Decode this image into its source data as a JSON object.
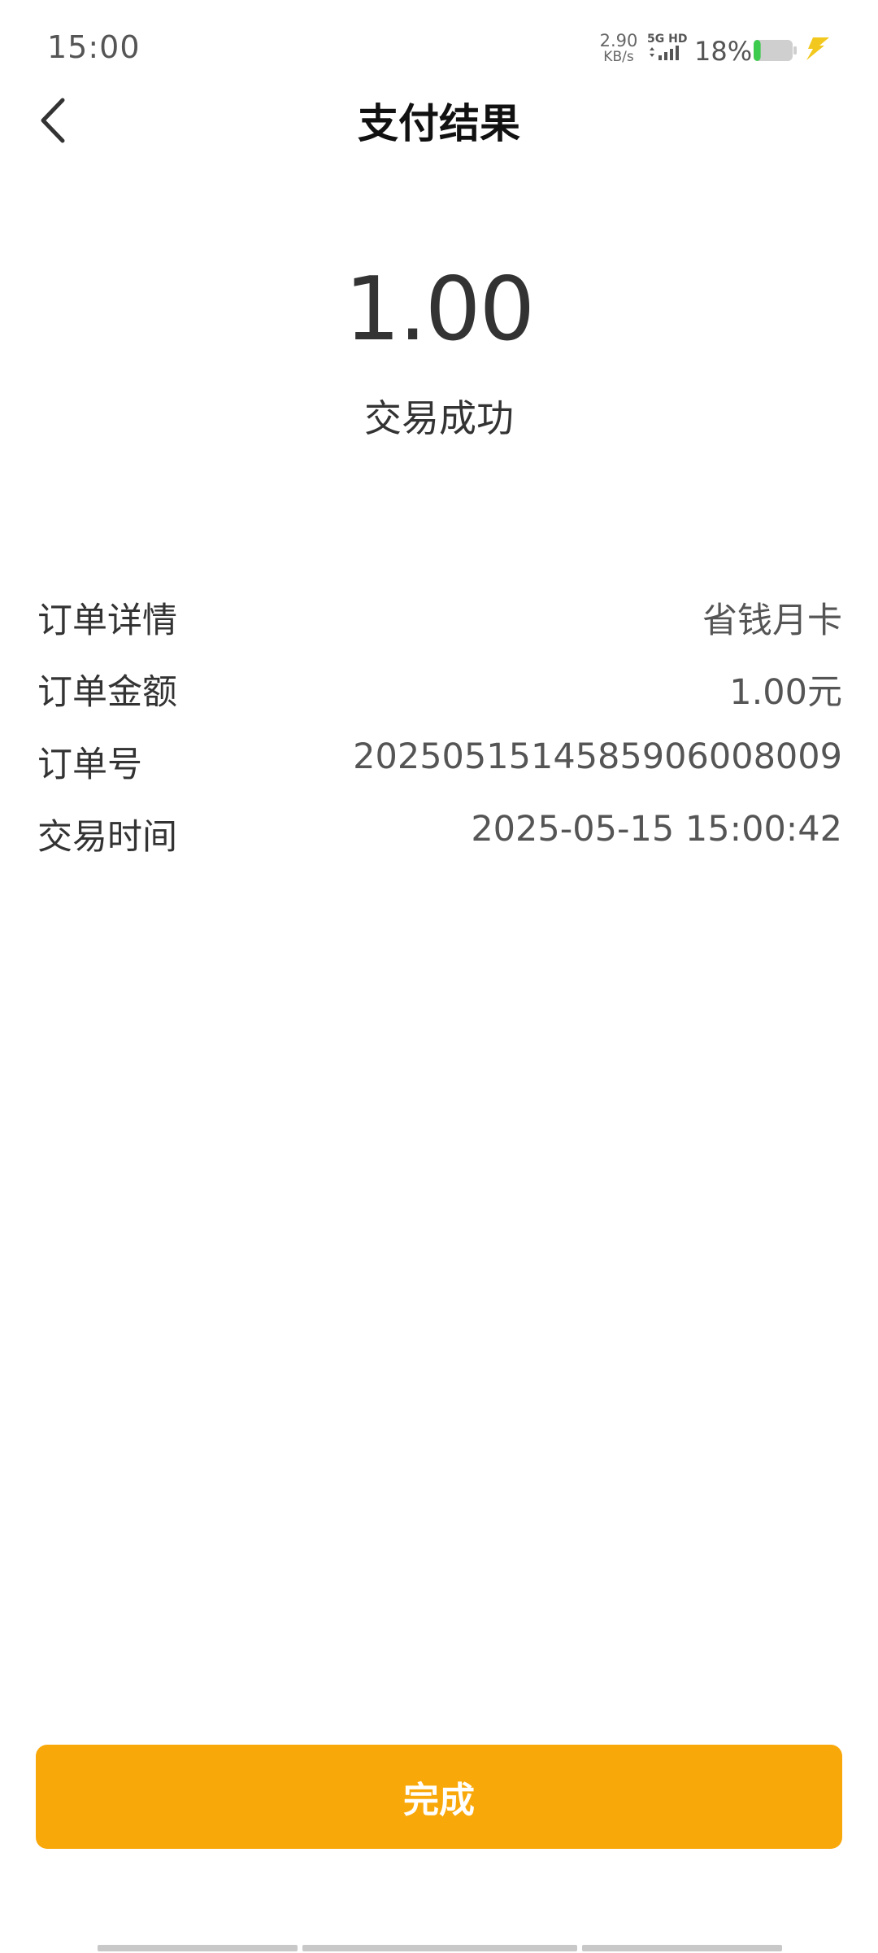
{
  "status_bar": {
    "time": "15:00",
    "net_speed_value": "2.90",
    "net_speed_unit": "KB/s",
    "network_label": "5G HD",
    "battery_percent": "18%",
    "battery_level": 0.18,
    "icons": [
      "signal-icon",
      "battery-icon",
      "charging-icon"
    ]
  },
  "nav": {
    "title": "支付结果",
    "back_icon": "chevron-left-icon"
  },
  "result": {
    "amount": "1.00",
    "status": "交易成功"
  },
  "details": [
    {
      "label": "订单详情",
      "value": "省钱月卡"
    },
    {
      "label": "订单金额",
      "value": "1.00元"
    },
    {
      "label": "订单号",
      "value": "20250515145859060080​09"
    },
    {
      "label": "交易时间",
      "value": "2025-05-15 15:00:42"
    }
  ],
  "actions": {
    "done_label": "完成"
  },
  "colors": {
    "accent": "#F9A80A",
    "battery_fill": "#3DCB4E",
    "charging": "#F2C81E"
  }
}
